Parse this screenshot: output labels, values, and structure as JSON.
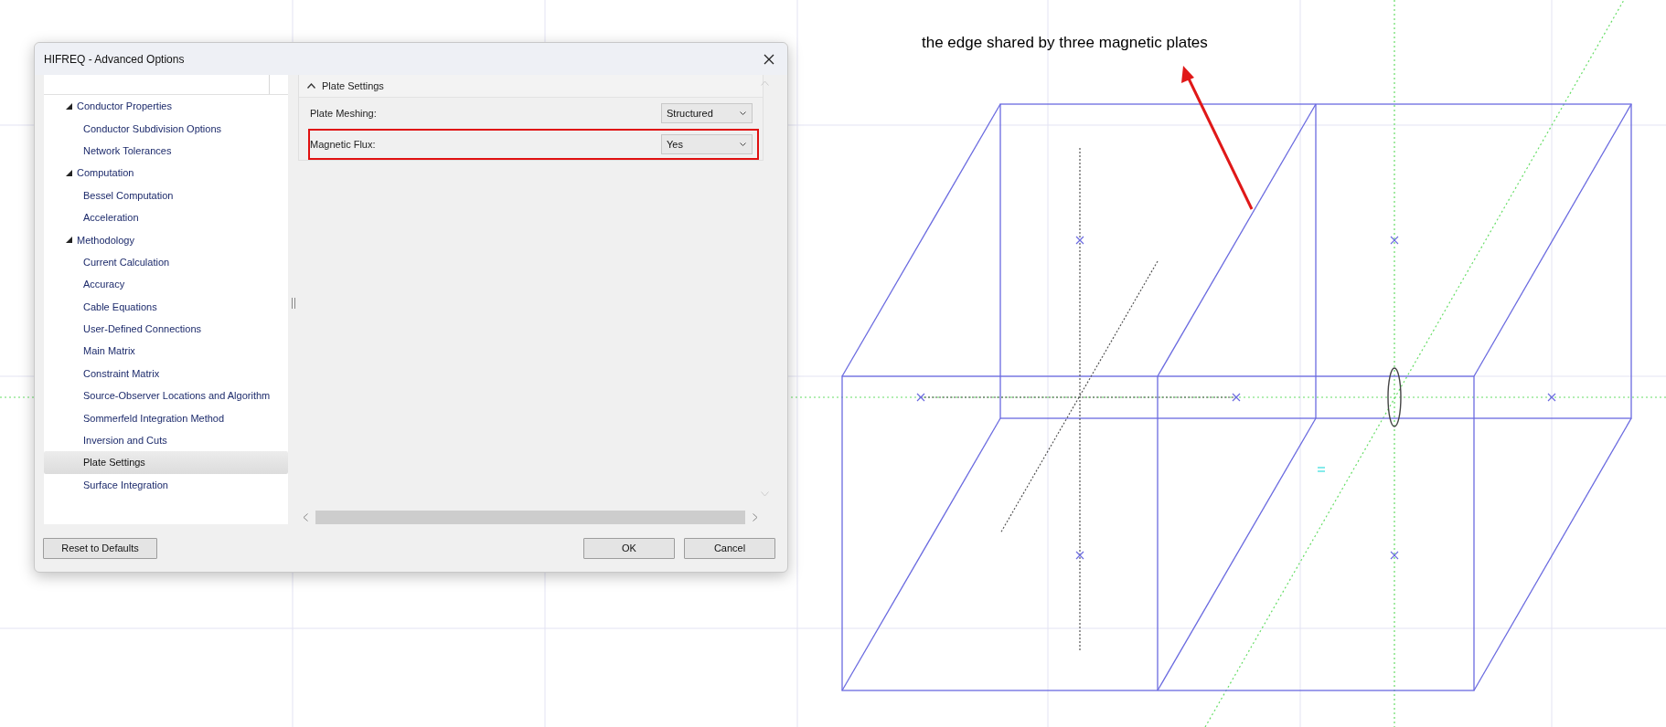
{
  "window": {
    "title": "HIFREQ - Advanced Options"
  },
  "tree": [
    {
      "label": "Conductor Properties",
      "expanded": true,
      "selected": false,
      "children": [
        {
          "label": "Conductor Subdivision Options",
          "selected": false
        },
        {
          "label": "Network Tolerances",
          "selected": false
        }
      ]
    },
    {
      "label": "Computation",
      "expanded": true,
      "selected": false,
      "children": [
        {
          "label": "Bessel Computation",
          "selected": false
        },
        {
          "label": "Acceleration",
          "selected": false
        }
      ]
    },
    {
      "label": "Methodology",
      "expanded": true,
      "selected": false,
      "children": [
        {
          "label": "Current Calculation",
          "selected": false
        },
        {
          "label": "Accuracy",
          "selected": false
        },
        {
          "label": "Cable Equations",
          "selected": false
        },
        {
          "label": "User-Defined Connections",
          "selected": false
        },
        {
          "label": "Main Matrix",
          "selected": false
        },
        {
          "label": "Constraint Matrix",
          "selected": false
        },
        {
          "label": "Source-Observer Locations and Algorithm",
          "selected": false
        },
        {
          "label": "Sommerfeld Integration Method",
          "selected": false
        },
        {
          "label": "Inversion and Cuts",
          "selected": false
        },
        {
          "label": "Plate Settings",
          "selected": true
        },
        {
          "label": "Surface Integration",
          "selected": false
        }
      ]
    }
  ],
  "panel": {
    "section": {
      "title": "Plate Settings",
      "expanded": true
    },
    "rows": [
      {
        "label": "Plate Meshing:",
        "value": "Structured",
        "highlighted": false
      },
      {
        "label": "Magnetic Flux:",
        "value": "Yes",
        "highlighted": true
      }
    ]
  },
  "buttons": {
    "reset": "Reset to Defaults",
    "ok": "OK",
    "cancel": "Cancel"
  },
  "annotation": {
    "text": "the edge shared by three magnetic plates"
  }
}
